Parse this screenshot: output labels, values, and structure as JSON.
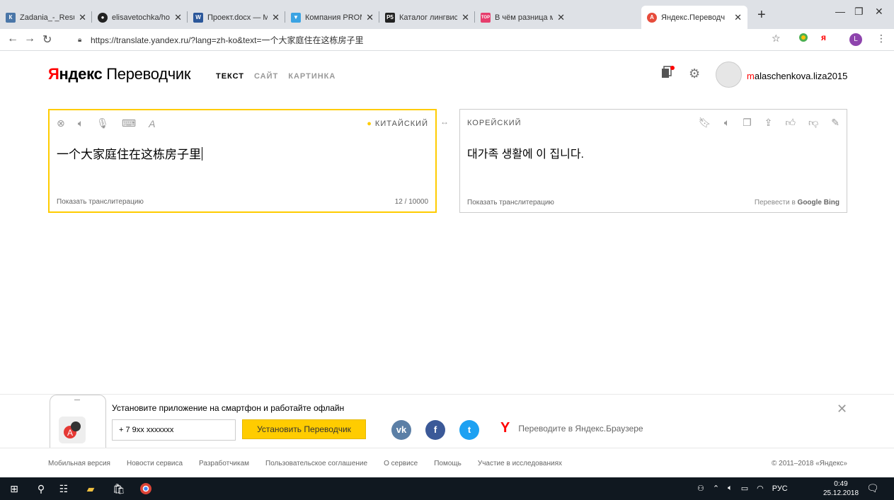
{
  "browser": {
    "tabs": [
      {
        "title": "Zadania_-_Resursy",
        "fav": "ВК",
        "color": "#4a76a8"
      },
      {
        "title": "elisavetochka/hom",
        "fav": "◉",
        "color": "#222"
      },
      {
        "title": "Проект.docx — M",
        "fav": "W",
        "color": "#2b579a"
      },
      {
        "title": "Компания PROMT",
        "fav": "▼",
        "color": "#3aa3e3"
      },
      {
        "title": "Каталог лингвисти",
        "fav": "P5",
        "color": "#222"
      },
      {
        "title": "В чём разница ма",
        "fav": "TOP",
        "color": "#e63e6d"
      },
      {
        "title": "Яндекс.Переводч",
        "fav": "A",
        "color": "#e74c3c"
      }
    ],
    "new_tab": "+",
    "url": "https://translate.yandex.ru/?lang=zh-ko&text=一个大家庭住在这栋房子里",
    "profile_initial": "L"
  },
  "header": {
    "logo_ya": "Я",
    "logo_ndeks": "ндекс",
    "logo_product": "Переводчик",
    "tabs": [
      "ТЕКСТ",
      "САЙТ",
      "КАРТИНКА"
    ],
    "username_first": "m",
    "username_rest": "alaschenkova.liza2015"
  },
  "source": {
    "language": "КИТАЙСКИЙ",
    "text": "一个大家庭住在这栋房子里",
    "translit": "Показать транслитерацию",
    "counter": "12 / 10000"
  },
  "target": {
    "language": "КОРЕЙСКИЙ",
    "text": "대가족 생활에 이 집니다.",
    "translit": "Показать транслитерацию",
    "translate_via": "Перевести в",
    "via_google": "Google",
    "via_bing": "Bing"
  },
  "swap": "↔",
  "promo": {
    "text": "Установите приложение на смартфон и работайте офлайн",
    "phone_value": "+ 7 9xx xxxxxxx",
    "install": "Установить Переводчик",
    "browser_link": "Переводите в Яндекс.Браузере",
    "social": [
      "vk",
      "f",
      "tw"
    ]
  },
  "footer": {
    "links": [
      "Мобильная версия",
      "Новости сервиса",
      "Разработчикам",
      "Пользовательское соглашение",
      "О сервисе",
      "Помощь",
      "Участие в исследованиях"
    ],
    "copyright": "© 2011–2018 «Яндекс»"
  },
  "taskbar": {
    "lang": "РУС",
    "time": "0:49",
    "date": "25.12.2018"
  }
}
